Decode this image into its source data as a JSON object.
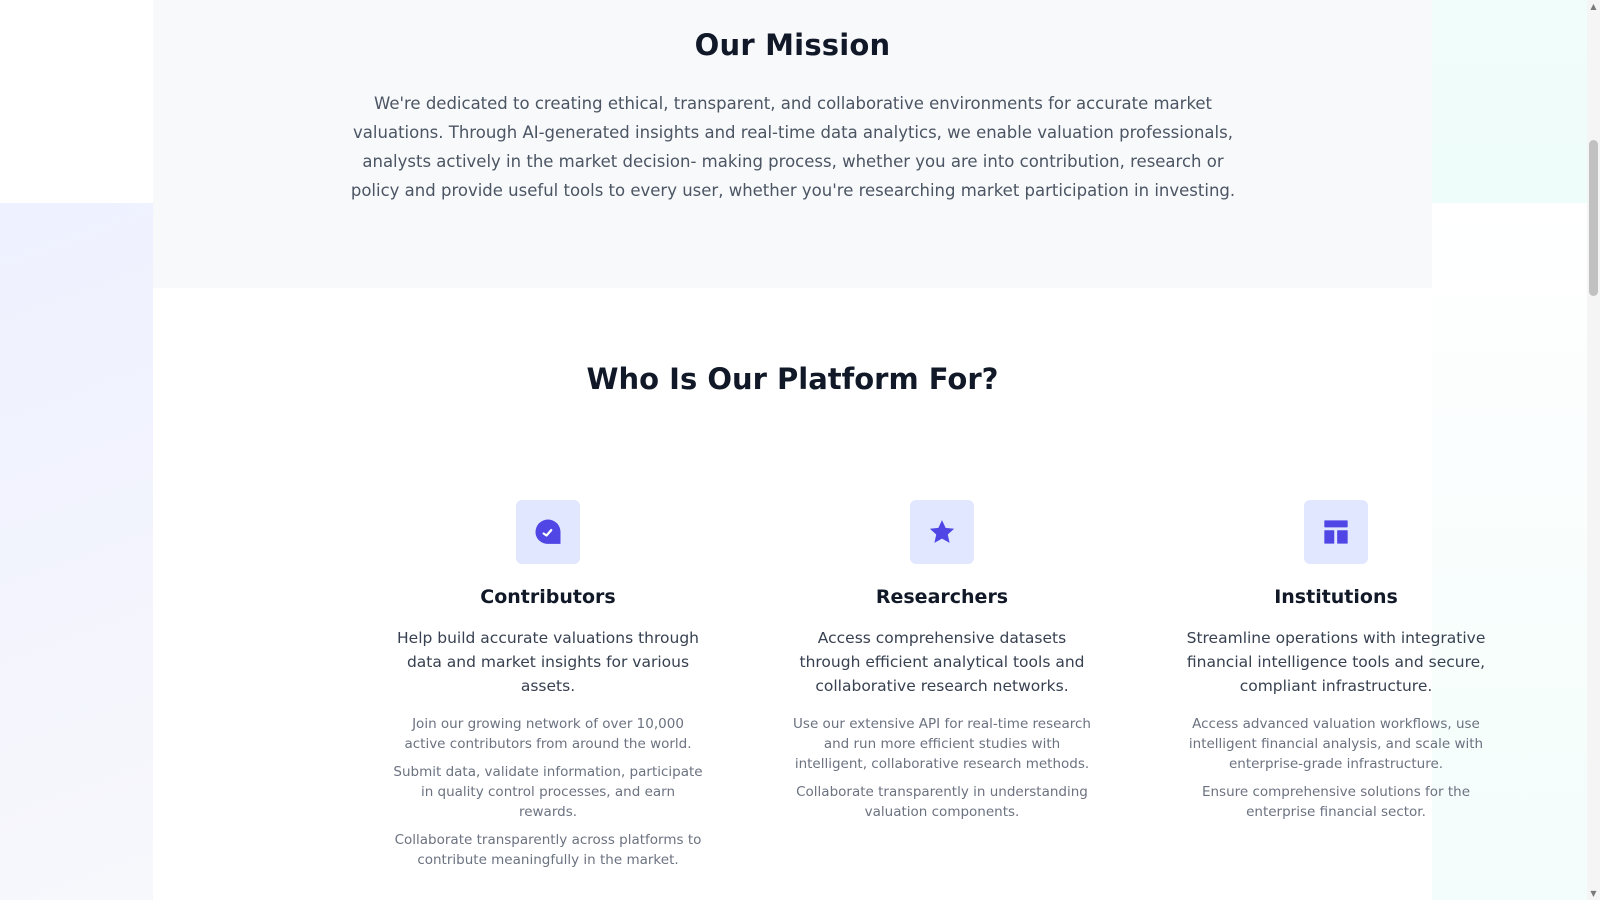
{
  "mission": {
    "title": "Our Mission",
    "text": "We're dedicated to creating ethical, transparent, and collaborative environments for accurate market valuations. Through AI-generated insights and real-time data analytics, we enable valuation professionals, analysts actively in the market decision- making process, whether you are into contribution, research or policy and provide useful tools to every user, whether you're researching market participation in investing."
  },
  "platform": {
    "title": "Who Is Our Platform For?",
    "cards": [
      {
        "icon": "gauge-icon",
        "title": "Contributors",
        "lead": "Help build accurate valuations through data and market insights for various assets.",
        "details": [
          "Join our growing network of over 10,000 active contributors from around the world.",
          "Submit data, validate information, participate in quality control processes, and earn rewards.",
          "Collaborate transparently across platforms to contribute meaningfully in the market."
        ]
      },
      {
        "icon": "star-icon",
        "title": "Researchers",
        "lead": "Access comprehensive datasets through efficient analytical tools and collaborative research networks.",
        "details": [
          "Use our extensive API for real-time research and run more efficient studies with intelligent, collaborative research methods.",
          "Collaborate transparently in understanding valuation components."
        ]
      },
      {
        "icon": "layout-icon",
        "title": "Institutions",
        "lead": "Streamline operations with integrative financial intelligence tools and secure, compliant infrastructure.",
        "details": [
          "Access advanced valuation workflows, use intelligent financial analysis, and scale with enterprise-grade infrastructure.",
          "Ensure comprehensive solutions for the enterprise financial sector."
        ]
      }
    ]
  },
  "colors": {
    "accent": "#4f46e5",
    "icon_bg": "#e0e7ff",
    "heading": "#111827",
    "body_text": "#4b5563",
    "muted_text": "#6b7280",
    "mission_bg": "#f8f9fb"
  }
}
